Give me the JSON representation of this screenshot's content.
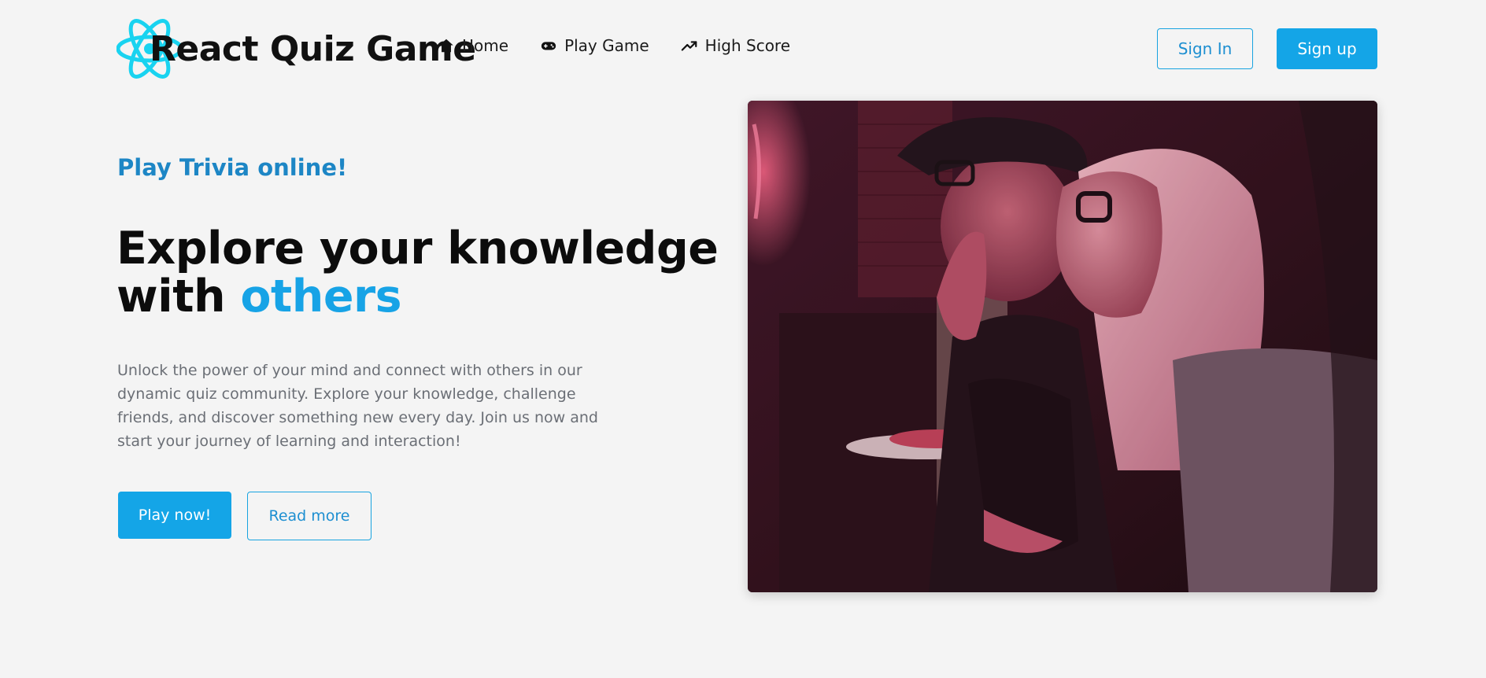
{
  "header": {
    "app_title": "React Quiz Game",
    "logo_icon": "react-atom-icon",
    "nav": [
      {
        "label": "Home",
        "icon": "home-icon"
      },
      {
        "label": "Play Game",
        "icon": "gamepad-icon"
      },
      {
        "label": "High Score",
        "icon": "trending-up-icon"
      }
    ],
    "sign_in_label": "Sign In",
    "sign_up_label": "Sign up"
  },
  "hero": {
    "tagline": "Play Trivia online!",
    "headline_line1": "Explore your knowledge",
    "headline_line2_prefix": "with ",
    "headline_accent": "others",
    "description": "Unlock the power of your mind and connect with others in our dynamic quiz community. Explore your knowledge, challenge friends, and discover something new every day. Join us now and start your journey of learning and interaction!",
    "play_button_label": "Play now!",
    "read_more_label": "Read more"
  },
  "colors": {
    "accent": "#14a5e7",
    "accent_text": "#1d86c5",
    "logo_cyan": "#19d3f0",
    "background": "#f4f4f4"
  }
}
